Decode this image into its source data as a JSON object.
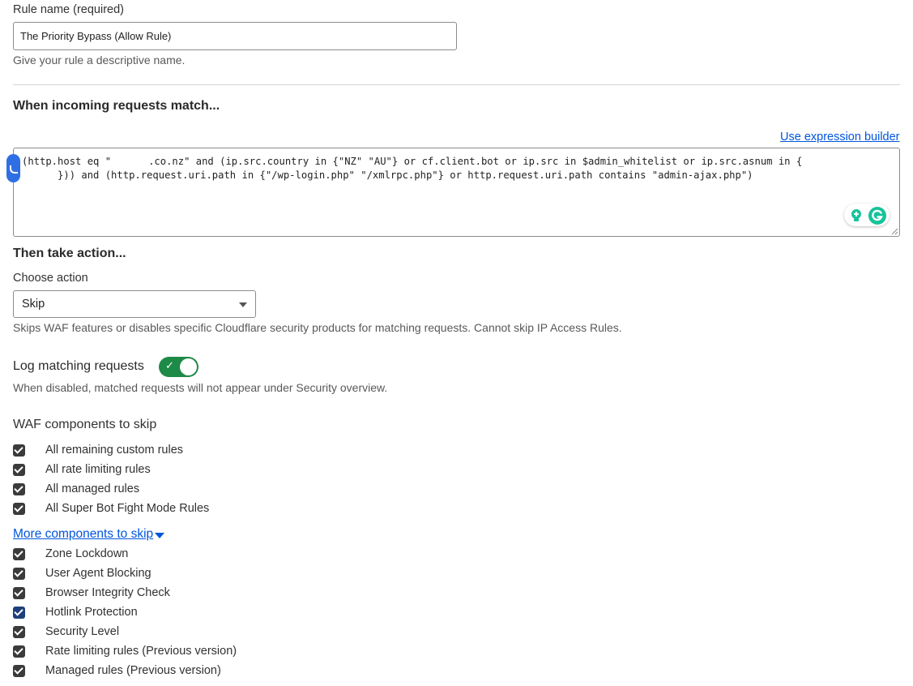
{
  "rule_name": {
    "label": "Rule name (required)",
    "value": "The Priority Bypass (Allow Rule)",
    "help": "Give your rule a descriptive name."
  },
  "match": {
    "heading": "When incoming requests match...",
    "builder_link": "Use expression builder",
    "expr_line1_a": "(http.host eq \"",
    "expr_line1_b": ".co.nz\" and (ip.src.country in {\"NZ\" \"AU\"} or cf.client.bot or ip.src in $admin_whitelist or ip.src.asnum in {",
    "expr_line2": "      })) and (http.request.uri.path in {\"/wp-login.php\" \"/xmlrpc.php\"} or http.request.uri.path contains \"admin-ajax.php\")"
  },
  "action": {
    "heading": "Then take action...",
    "label": "Choose action",
    "selected": "Skip",
    "help": "Skips WAF features or disables specific Cloudflare security products for matching requests. Cannot skip IP Access Rules."
  },
  "logging": {
    "label": "Log matching requests",
    "toggle_on": true,
    "check_glyph": "✓",
    "help": "When disabled, matched requests will not appear under Security overview."
  },
  "waf": {
    "heading": "WAF components to skip",
    "items": [
      {
        "label": "All remaining custom rules",
        "checked": true
      },
      {
        "label": "All rate limiting rules",
        "checked": true
      },
      {
        "label": "All managed rules",
        "checked": true
      },
      {
        "label": "All Super Bot Fight Mode Rules",
        "checked": true
      }
    ]
  },
  "more": {
    "link": "More components to skip",
    "items": [
      {
        "label": "Zone Lockdown",
        "checked": true
      },
      {
        "label": "User Agent Blocking",
        "checked": true
      },
      {
        "label": "Browser Integrity Check",
        "checked": true
      },
      {
        "label": "Hotlink Protection",
        "checked": true
      },
      {
        "label": "Security Level",
        "checked": true
      },
      {
        "label": "Rate limiting rules (Previous version)",
        "checked": true
      },
      {
        "label": "Managed rules (Previous version)",
        "checked": true
      }
    ]
  },
  "colors": {
    "link": "#0055dc",
    "toggle_on": "#1e8a47",
    "grammarly": "#15c39a"
  }
}
